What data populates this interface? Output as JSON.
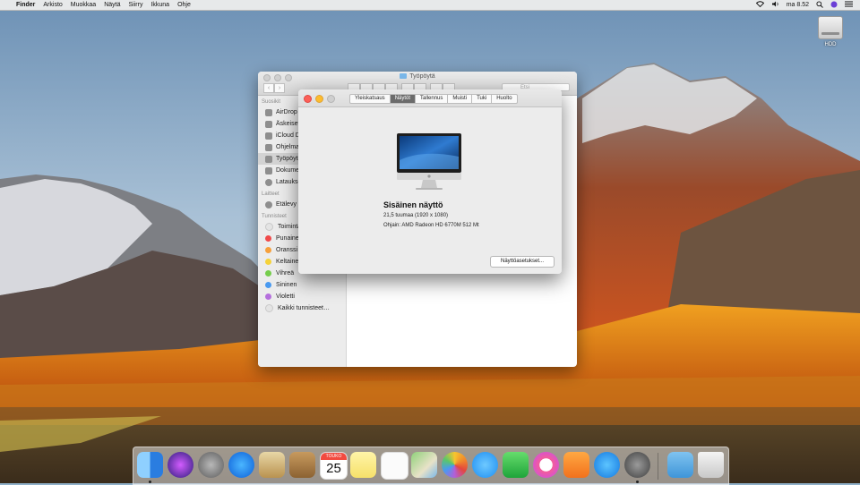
{
  "menubar": {
    "apple": "",
    "app": "Finder",
    "items": [
      "Arkisto",
      "Muokkaa",
      "Näytä",
      "Siirry",
      "Ikkuna",
      "Ohje"
    ],
    "clock": "ma 8.52"
  },
  "desktop": {
    "hdd_label": "HDD"
  },
  "finder": {
    "title": "Työpöytä",
    "nav_back": "‹",
    "nav_forward": "›",
    "search_placeholder": "Etsi",
    "sections": {
      "favorites": "Suosikit",
      "devices": "Laitteet",
      "tags": "Tunnisteet"
    },
    "favorites": [
      "AirDrop",
      "Äskeiset",
      "iCloud Drive",
      "Ohjelmat",
      "Työpöytä",
      "Dokumentit",
      "Lataukset"
    ],
    "devices": [
      "Etälevy"
    ],
    "tags": [
      "Toiminta",
      "Punainen",
      "Oranssi",
      "Keltainen",
      "Vihreä",
      "Sininen",
      "Violetti",
      "Kaikki tunnisteet…"
    ],
    "tag_colors": [
      "#e4e4e4",
      "#f04a4a",
      "#f6a03c",
      "#f5d23a",
      "#75cd4c",
      "#4a9af0",
      "#b570dd",
      "#e4e4e4"
    ]
  },
  "about": {
    "tabs": [
      "Yleiskatsaus",
      "Näytöt",
      "Tallennus",
      "Muisti",
      "Tuki",
      "Huolto"
    ],
    "active_tab": "Näytöt",
    "display_name": "Sisäinen näyttö",
    "display_size": "21,5 tuumaa (1920 x 1080)",
    "display_driver": "Ohjain: AMD Radeon HD 6770M 512 Mt",
    "settings_button": "Näyttöasetukset..."
  },
  "dock": {
    "apps": [
      "Finder",
      "Siri",
      "Launchpad",
      "Safari",
      "Mail",
      "Contacts",
      "Calendar",
      "Notes",
      "Reminders",
      "Maps",
      "Photos",
      "Messages",
      "FaceTime",
      "iTunes",
      "iBooks",
      "App Store",
      "System Preferences",
      "Downloads",
      "Trash"
    ],
    "calendar_month": "TOUKO",
    "calendar_day": "25"
  }
}
